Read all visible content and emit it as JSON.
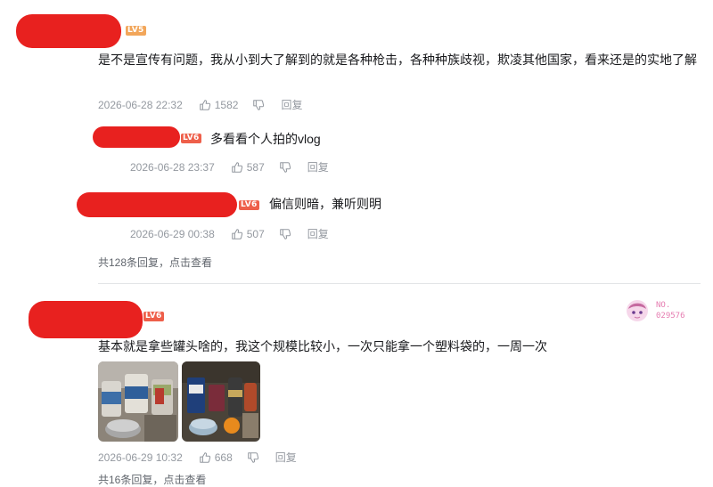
{
  "comments": [
    {
      "level": "LV5",
      "text": "是不是宣传有问题，我从小到大了解到的就是各种枪击，各种种族歧视，欺凌其他国家，看来还是的实地了解",
      "time": "2026-06-28 22:32",
      "likes": "1582",
      "reply_label": "回复",
      "replies": [
        {
          "level": "LV6",
          "text": "多看看个人拍的vlog",
          "time": "2026-06-28 23:37",
          "likes": "587",
          "reply_label": "回复"
        },
        {
          "level": "LV6",
          "text": "偏信则暗，兼听则明",
          "time": "2026-06-29 00:38",
          "likes": "507",
          "reply_label": "回复"
        }
      ],
      "more_replies": {
        "count_text": "共128条回复，",
        "action": "点击查看"
      }
    },
    {
      "level": "LV6",
      "text": "基本就是拿些罐头啥的，我这个规模比较小，一次只能拿一个塑料袋的，一周一次",
      "time": "2026-06-29 10:32",
      "likes": "668",
      "reply_label": "回复",
      "badge": {
        "label": "NO.",
        "number": "029576"
      },
      "more_replies": {
        "count_text": "共16条回复，",
        "action": "点击查看"
      }
    }
  ],
  "icons": [
    "like-icon",
    "dislike-icon"
  ],
  "colors": {
    "redaction": "#e8211f",
    "meta": "#9499a0",
    "lv5": "#f2a65a",
    "lv6": "#ee5f4a",
    "badge": "#e67db1"
  }
}
